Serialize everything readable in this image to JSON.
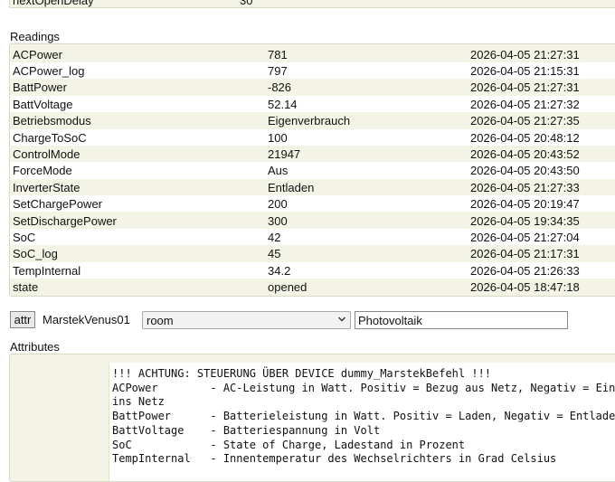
{
  "top_row": {
    "name": "nextOpenDelay",
    "value": "30"
  },
  "readings": {
    "title": "Readings",
    "rows": [
      {
        "name": "ACPower",
        "value": "781",
        "time": "2026-04-05 21:27:31"
      },
      {
        "name": "ACPower_log",
        "value": "797",
        "time": "2026-04-05 21:15:31"
      },
      {
        "name": "BattPower",
        "value": "-826",
        "time": "2026-04-05 21:27:31"
      },
      {
        "name": "BattVoltage",
        "value": "52.14",
        "time": "2026-04-05 21:27:32"
      },
      {
        "name": "Betriebsmodus",
        "value": "Eigenverbrauch",
        "time": "2026-04-05 21:27:35"
      },
      {
        "name": "ChargeToSoC",
        "value": "100",
        "time": "2026-04-05 20:48:12"
      },
      {
        "name": "ControlMode",
        "value": "21947",
        "time": "2026-04-05 20:43:52"
      },
      {
        "name": "ForceMode",
        "value": "Aus",
        "time": "2026-04-05 20:43:50"
      },
      {
        "name": "InverterState",
        "value": "Entladen",
        "time": "2026-04-05 21:27:33"
      },
      {
        "name": "SetChargePower",
        "value": "200",
        "time": "2026-04-05 20:19:47"
      },
      {
        "name": "SetDischargePower",
        "value": "300",
        "time": "2026-04-05 19:34:35"
      },
      {
        "name": "SoC",
        "value": "42",
        "time": "2026-04-05 21:27:04"
      },
      {
        "name": "SoC_log",
        "value": "45",
        "time": "2026-04-05 21:17:31"
      },
      {
        "name": "TempInternal",
        "value": "34.2",
        "time": "2026-04-05 21:26:33"
      },
      {
        "name": "state",
        "value": "opened",
        "time": "2026-04-05 18:47:18"
      }
    ]
  },
  "attr_bar": {
    "button_label": "attr",
    "device_name": "MarstekVenus01",
    "selected_attribute": "room",
    "input_value": "Photovoltaik"
  },
  "attributes": {
    "title": "Attributes",
    "comment_lines": [
      "!!! ACHTUNG: STEUERUNG ÜBER DEVICE dummy_MarstekBefehl !!!",
      "ACPower        - AC-Leistung in Watt. Positiv = Bezug aus Netz, Negativ = Einspeisung",
      "ins Netz",
      "BattPower      - Batterieleistung in Watt. Positiv = Laden, Negativ = Entladen",
      "BattVoltage    - Batteriespannung in Volt",
      "SoC            - State of Charge, Ladestand in Prozent",
      "TempInternal   - Innentemperatur des Wechselrichters in Grad Celsius"
    ]
  },
  "colors": {
    "table_bg": "#f4f4e6",
    "border": "#d9d9c8",
    "row_alt": "#ffffff"
  },
  "icons": {
    "select_chevron": "chevron-down-icon"
  }
}
